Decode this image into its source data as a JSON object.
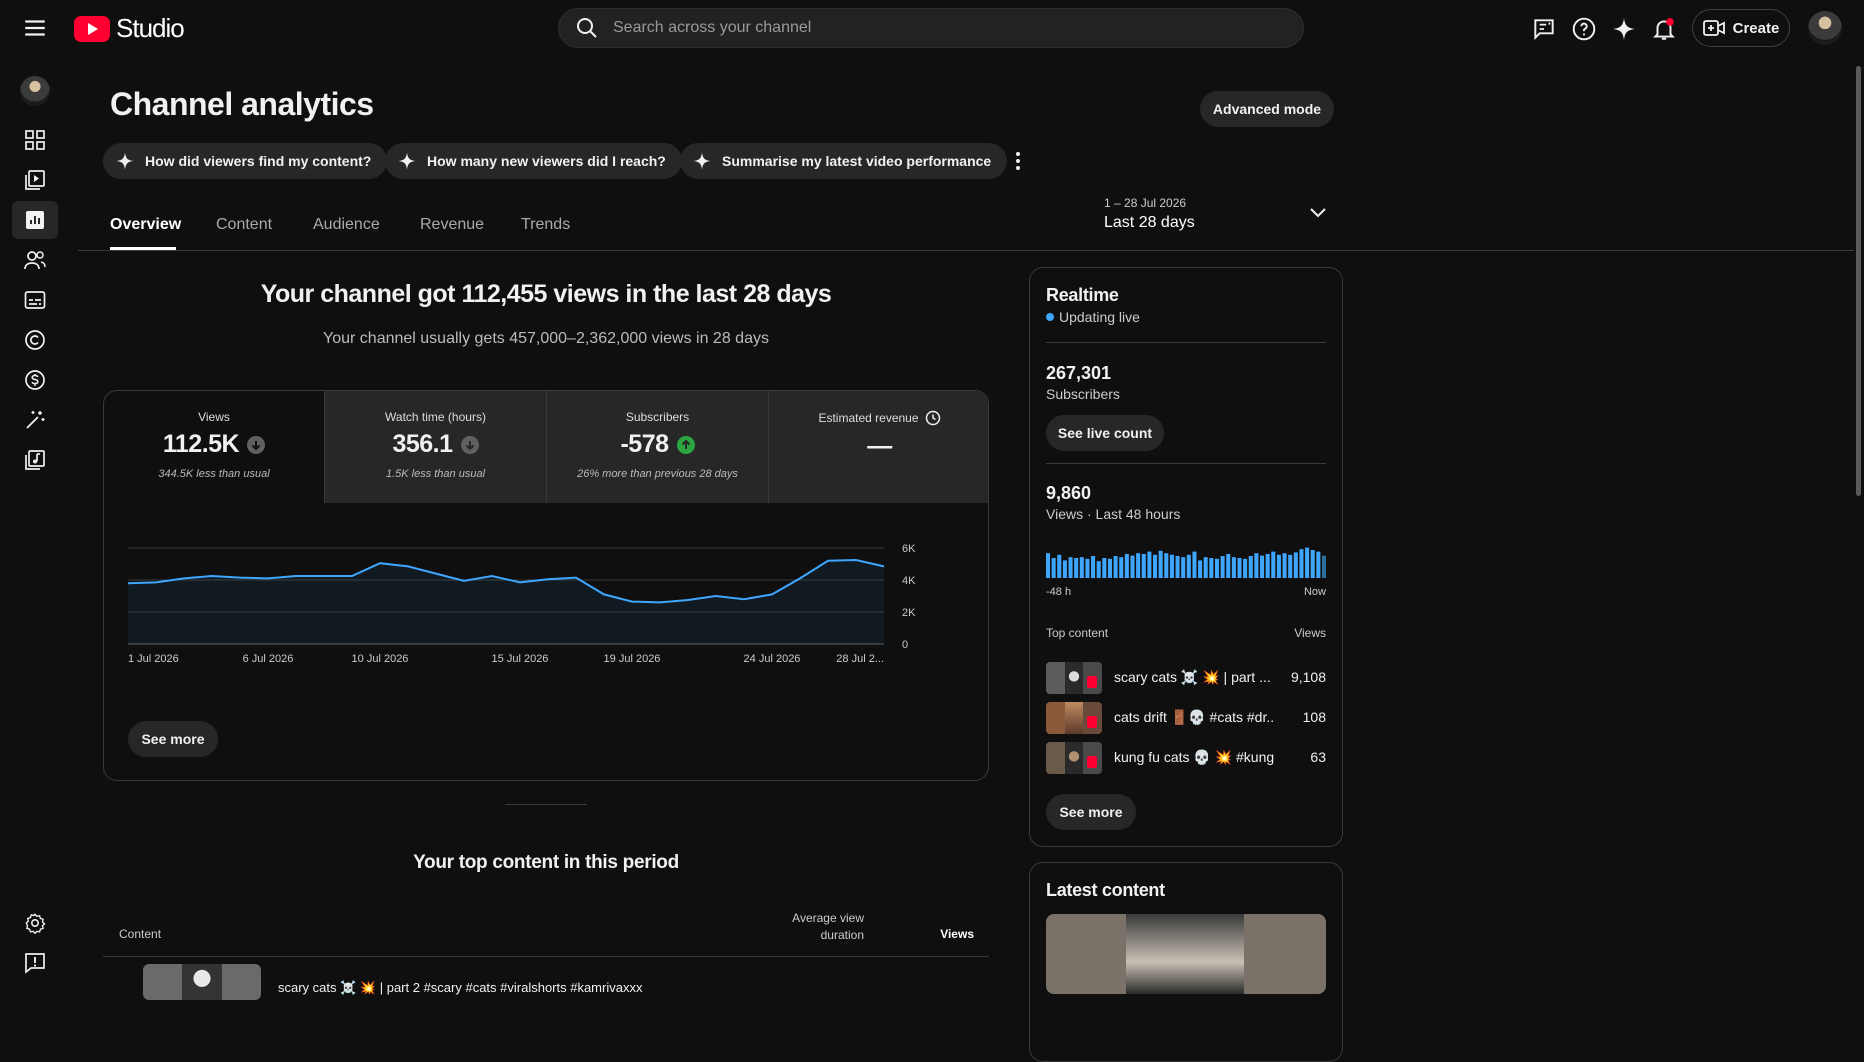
{
  "app": {
    "logo_text": "Studio"
  },
  "search": {
    "placeholder": "Search across your channel"
  },
  "header": {
    "create_label": "Create"
  },
  "page": {
    "title": "Channel analytics",
    "advanced_mode_label": "Advanced mode",
    "suggestion_chips": [
      "How did viewers find my content?",
      "How many new viewers did I reach?",
      "Summarise my latest video performance"
    ],
    "tabs": [
      "Overview",
      "Content",
      "Audience",
      "Revenue",
      "Trends"
    ],
    "active_tab": "Overview",
    "date_range": {
      "range": "1 – 28 Jul 2026",
      "label": "Last 28 days"
    }
  },
  "overview": {
    "headline": "Your channel got 112,455 views in the last 28 days",
    "subline": "Your channel usually gets 457,000–2,362,000 views in 28 days",
    "metrics": [
      {
        "label": "Views",
        "value": "112.5K",
        "trend": "down",
        "sub": "344.5K less than usual"
      },
      {
        "label": "Watch time (hours)",
        "value": "356.1",
        "trend": "down",
        "sub": "1.5K less than usual"
      },
      {
        "label": "Subscribers",
        "value": "-578",
        "trend": "up",
        "sub": "26% more than previous 28 days"
      },
      {
        "label": "Estimated revenue",
        "value": "—",
        "trend": "none",
        "sub": ""
      }
    ],
    "see_more_label": "See more"
  },
  "chart_data": {
    "type": "area",
    "series": [
      {
        "name": "Views",
        "values": [
          3800,
          3850,
          4100,
          4250,
          4150,
          4100,
          4250,
          4250,
          4250,
          5050,
          4850,
          4400,
          3950,
          4250,
          3850,
          4050,
          4150,
          3100,
          2650,
          2600,
          2750,
          3000,
          2800,
          3100,
          4100,
          5200,
          5250,
          4850
        ]
      }
    ],
    "x_tick_labels": [
      "1 Jul 2026",
      "6 Jul 2026",
      "10 Jul 2026",
      "15 Jul 2026",
      "19 Jul 2026",
      "24 Jul 2026",
      "28 Jul 2..."
    ],
    "y_tick_labels": [
      "6K",
      "4K",
      "2K",
      "0"
    ],
    "ylim": [
      0,
      6000
    ],
    "grid": true,
    "color": "#3ea6ff"
  },
  "top_content": {
    "title": "Your top content in this period",
    "col_content": "Content",
    "col_avd": "Average view duration",
    "col_views": "Views",
    "first_row_title": "scary cats ☠️ 💥 | part 2 #scary #cats #viralshorts #kamrivaxxx"
  },
  "realtime": {
    "title": "Realtime",
    "status": "Updating live",
    "subscribers_value": "267,301",
    "subscribers_label": "Subscribers",
    "see_live_count_label": "See live count",
    "views_value": "9,860",
    "views_label": "Views · Last 48 hours",
    "bars": [
      0.62,
      0.5,
      0.58,
      0.44,
      0.52,
      0.5,
      0.52,
      0.48,
      0.55,
      0.42,
      0.5,
      0.48,
      0.55,
      0.52,
      0.6,
      0.56,
      0.62,
      0.6,
      0.66,
      0.58,
      0.68,
      0.62,
      0.58,
      0.55,
      0.52,
      0.58,
      0.66,
      0.44,
      0.52,
      0.5,
      0.48,
      0.55,
      0.6,
      0.52,
      0.5,
      0.48,
      0.55,
      0.62,
      0.56,
      0.6,
      0.66,
      0.58,
      0.62,
      0.58,
      0.64,
      0.72,
      0.76,
      0.7,
      0.66,
      0.56
    ],
    "bar_left_label": "-48 h",
    "bar_right_label": "Now",
    "top_content_label": "Top content",
    "top_content_views_label": "Views",
    "top_items": [
      {
        "title": "scary cats ☠️ 💥 | part ...",
        "views": "9,108"
      },
      {
        "title": "cats drift 🚪💀 #cats #dr...",
        "views": "108"
      },
      {
        "title": "kung fu cats 💀 💥 #kung...",
        "views": "63"
      }
    ],
    "see_more_label": "See more"
  },
  "latest_content": {
    "title": "Latest content"
  },
  "colors": {
    "accent": "#3ea6ff",
    "brand_red": "#ff0033",
    "up_green": "#2ba640",
    "bg": "#0f0f0f"
  }
}
